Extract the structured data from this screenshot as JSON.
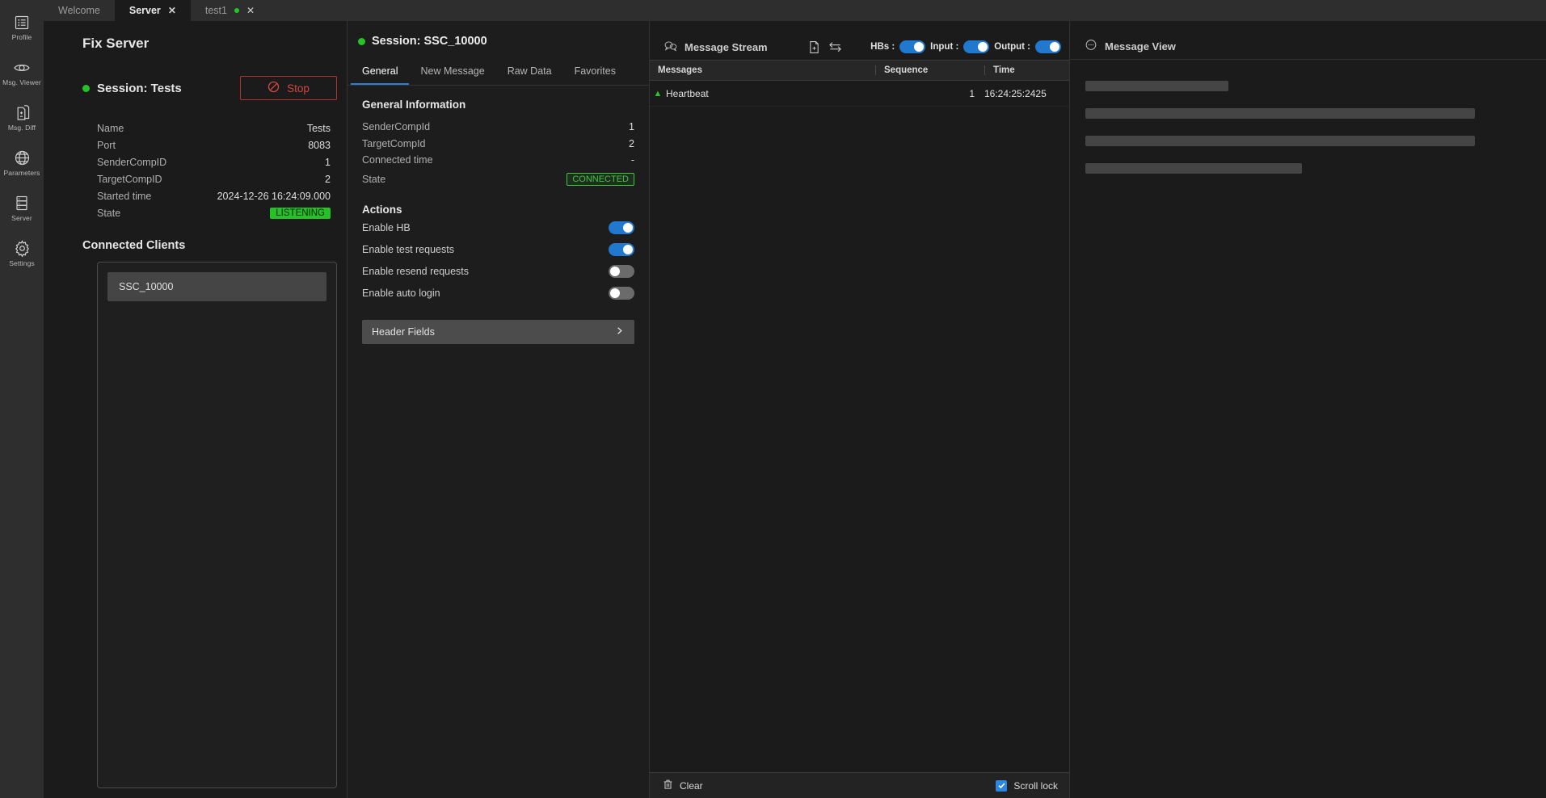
{
  "activity_bar": {
    "items": [
      {
        "label": "Profile",
        "icon": "list-icon"
      },
      {
        "label": "Msg. Viewer",
        "icon": "eye-icon"
      },
      {
        "label": "Msg. Diff",
        "icon": "document-diff-icon"
      },
      {
        "label": "Parameters",
        "icon": "globe-icon"
      },
      {
        "label": "Server",
        "icon": "server-stack-icon"
      },
      {
        "label": "Settings",
        "icon": "gear-icon"
      }
    ]
  },
  "tabs": [
    {
      "label": "Welcome",
      "active": false,
      "closable": false,
      "modified": false
    },
    {
      "label": "Server",
      "active": true,
      "closable": true,
      "modified": false
    },
    {
      "label": "test1",
      "active": false,
      "closable": true,
      "modified": true
    }
  ],
  "server_panel": {
    "title": "Fix Server",
    "session_heading": "Session: Tests",
    "stop_label": "Stop",
    "fields": [
      {
        "key": "Name",
        "value": "Tests"
      },
      {
        "key": "Port",
        "value": "8083"
      },
      {
        "key": "SenderCompID",
        "value": "1"
      },
      {
        "key": "TargetCompID",
        "value": "2"
      },
      {
        "key": "Started time",
        "value": "2024-12-26 16:24:09.000"
      }
    ],
    "state_key": "State",
    "state_value": "LISTENING",
    "connected_clients_title": "Connected Clients",
    "clients": [
      "SSC_10000"
    ]
  },
  "session_panel": {
    "heading": "Session: SSC_10000",
    "tabs": [
      {
        "label": "General",
        "active": true
      },
      {
        "label": "New Message",
        "active": false
      },
      {
        "label": "Raw Data",
        "active": false
      },
      {
        "label": "Favorites",
        "active": false
      }
    ],
    "general_information_title": "General Information",
    "fields": [
      {
        "key": "SenderCompId",
        "value": "1"
      },
      {
        "key": "TargetCompId",
        "value": "2"
      },
      {
        "key": "Connected time",
        "value": "-"
      }
    ],
    "state_key": "State",
    "state_value": "CONNECTED",
    "actions_title": "Actions",
    "actions": [
      {
        "label": "Enable HB",
        "on": true
      },
      {
        "label": "Enable test requests",
        "on": true
      },
      {
        "label": "Enable resend requests",
        "on": false
      },
      {
        "label": "Enable auto login",
        "on": false
      }
    ],
    "header_fields_label": "Header Fields"
  },
  "stream_panel": {
    "title": "Message Stream",
    "title_icon": "chat-bubbles-icon",
    "copy_icon": "document-icon",
    "swap_icon": "swap-arrows-icon",
    "switches": [
      {
        "label": "HBs :",
        "on": true
      },
      {
        "label": "Input :",
        "on": true
      },
      {
        "label": "Output :",
        "on": true
      }
    ],
    "columns": [
      "Messages",
      "Sequence",
      "Time"
    ],
    "rows": [
      {
        "direction": "out",
        "message": "Heartbeat",
        "sequence": "1",
        "time": "16:24:25:2425"
      }
    ],
    "clear_label": "Clear",
    "scroll_lock_label": "Scroll lock",
    "scroll_lock_checked": true
  },
  "view_panel": {
    "title": "Message View",
    "title_icon": "chat-dots-icon",
    "skeleton_widths": [
      "31%",
      "84.5%",
      "84.5%",
      "47%"
    ]
  },
  "colors": {
    "accent_blue": "#2079cf",
    "status_green": "#27c127",
    "danger_red": "#d24743",
    "panel_bg": "#1b1b1b",
    "chrome_bg": "#2e2e2e"
  }
}
